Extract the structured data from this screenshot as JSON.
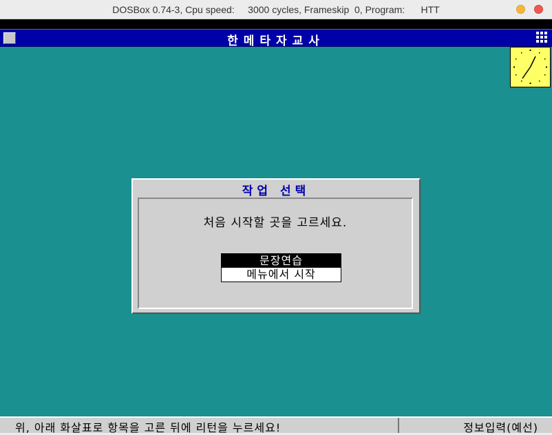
{
  "window": {
    "title": "DOSBox 0.74-3, Cpu speed:     3000 cycles, Frameskip  0, Program:      HTT"
  },
  "app": {
    "title": "한메타자교사"
  },
  "dialog": {
    "title": "작업 선택",
    "message": "처음 시작할 곳을 고르세요.",
    "options": [
      {
        "label": "문장연습",
        "selected": true
      },
      {
        "label": "메뉴에서 시작",
        "selected": false
      }
    ]
  },
  "status": {
    "hint": "위, 아래 화살표로 항목을 고른 뒤에 리턴을 누르세요!",
    "mode": "정보입력(예선)"
  },
  "colors": {
    "desktop": "#1a9090",
    "title_bar": "#0000a8",
    "clock": "#ffff66",
    "dialog": "#d0d0d0"
  },
  "icons": {
    "clock": "analog-clock-icon",
    "system_menu": "system-menu-icon",
    "grid": "grid-menu-icon"
  }
}
